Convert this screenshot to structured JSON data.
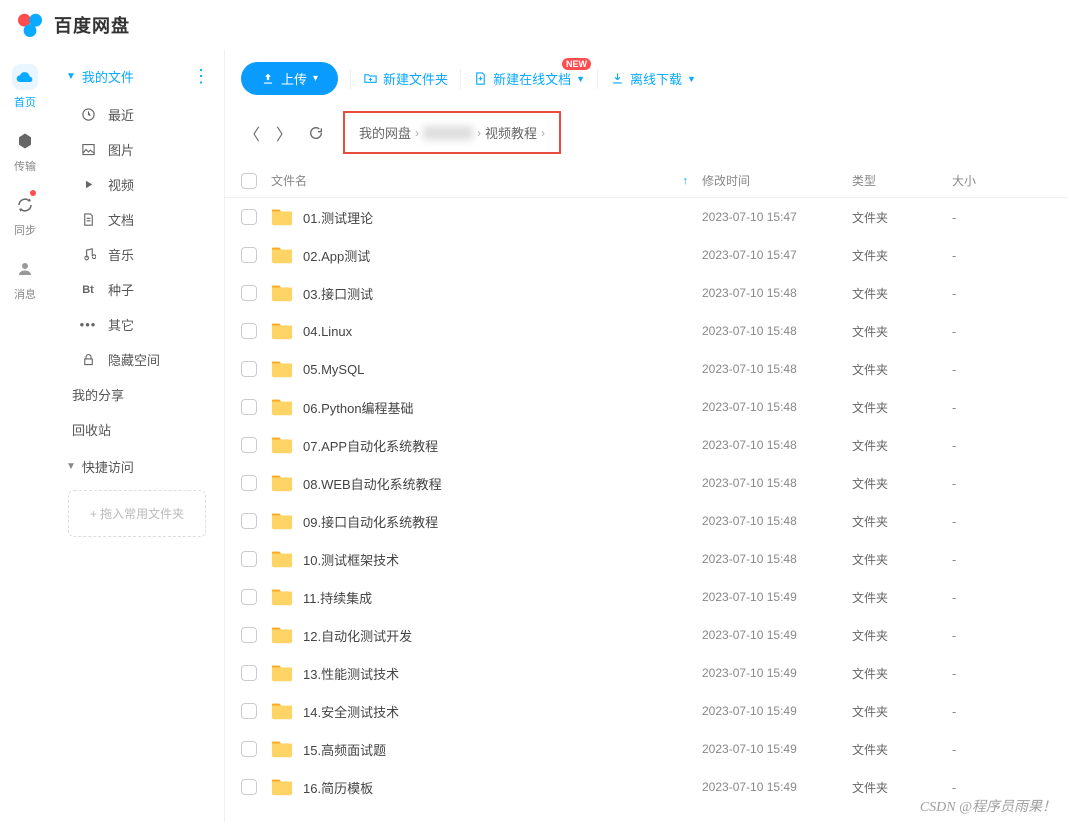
{
  "app": {
    "name": "百度网盘"
  },
  "leftbar": [
    {
      "label": "首页",
      "icon": "cloud",
      "active": true
    },
    {
      "label": "传输",
      "icon": "transfer"
    },
    {
      "label": "同步",
      "icon": "sync",
      "dot": true
    },
    {
      "label": "消息",
      "icon": "user"
    }
  ],
  "sidebar": {
    "my_files": "我的文件",
    "items": [
      {
        "label": "最近",
        "icon": "clock"
      },
      {
        "label": "图片",
        "icon": "image"
      },
      {
        "label": "视频",
        "icon": "video"
      },
      {
        "label": "文档",
        "icon": "doc"
      },
      {
        "label": "音乐",
        "icon": "music"
      },
      {
        "label": "种子",
        "icon": "bt"
      },
      {
        "label": "其它",
        "icon": "more"
      },
      {
        "label": "隐藏空间",
        "icon": "lock"
      }
    ],
    "my_share": "我的分享",
    "recycle": "回收站",
    "quick_access": "快捷访问",
    "drag_hint": "+ 拖入常用文件夹"
  },
  "toolbar": {
    "upload": "上传",
    "new_folder": "新建文件夹",
    "new_online_doc": "新建在线文档",
    "offline_download": "离线下载",
    "new_badge": "NEW"
  },
  "breadcrumb": {
    "root": "我的网盘",
    "current": "视频教程"
  },
  "table": {
    "headers": {
      "name": "文件名",
      "time": "修改时间",
      "type": "类型",
      "size": "大小"
    }
  },
  "files": [
    {
      "name": "01.测试理论",
      "time": "2023-07-10 15:47",
      "type": "文件夹",
      "size": "-"
    },
    {
      "name": "02.App测试",
      "time": "2023-07-10 15:47",
      "type": "文件夹",
      "size": "-"
    },
    {
      "name": "03.接口测试",
      "time": "2023-07-10 15:48",
      "type": "文件夹",
      "size": "-"
    },
    {
      "name": "04.Linux",
      "time": "2023-07-10 15:48",
      "type": "文件夹",
      "size": "-"
    },
    {
      "name": "05.MySQL",
      "time": "2023-07-10 15:48",
      "type": "文件夹",
      "size": "-"
    },
    {
      "name": "06.Python编程基础",
      "time": "2023-07-10 15:48",
      "type": "文件夹",
      "size": "-"
    },
    {
      "name": "07.APP自动化系统教程",
      "time": "2023-07-10 15:48",
      "type": "文件夹",
      "size": "-"
    },
    {
      "name": "08.WEB自动化系统教程",
      "time": "2023-07-10 15:48",
      "type": "文件夹",
      "size": "-"
    },
    {
      "name": "09.接口自动化系统教程",
      "time": "2023-07-10 15:48",
      "type": "文件夹",
      "size": "-"
    },
    {
      "name": "10.测试框架技术",
      "time": "2023-07-10 15:48",
      "type": "文件夹",
      "size": "-"
    },
    {
      "name": "11.持续集成",
      "time": "2023-07-10 15:49",
      "type": "文件夹",
      "size": "-"
    },
    {
      "name": "12.自动化测试开发",
      "time": "2023-07-10 15:49",
      "type": "文件夹",
      "size": "-"
    },
    {
      "name": "13.性能测试技术",
      "time": "2023-07-10 15:49",
      "type": "文件夹",
      "size": "-"
    },
    {
      "name": "14.安全测试技术",
      "time": "2023-07-10 15:49",
      "type": "文件夹",
      "size": "-"
    },
    {
      "name": "15.高频面试题",
      "time": "2023-07-10 15:49",
      "type": "文件夹",
      "size": "-"
    },
    {
      "name": "16.简历模板",
      "time": "2023-07-10 15:49",
      "type": "文件夹",
      "size": "-"
    }
  ],
  "watermark": "CSDN @程序员雨果！"
}
